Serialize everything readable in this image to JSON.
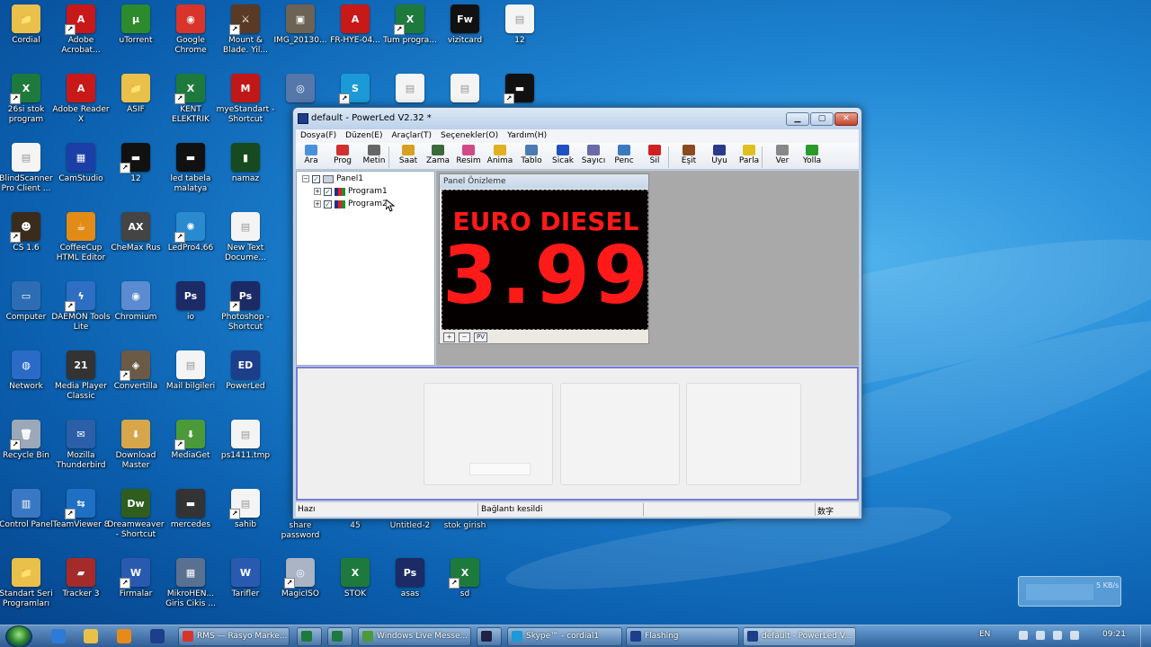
{
  "desktop": {
    "icons": [
      {
        "label": "Cordial",
        "color": "#e9c14a",
        "glyph": "📁"
      },
      {
        "label": "Adobe Acrobat...",
        "color": "#c91818",
        "glyph": "A"
      },
      {
        "label": "uTorrent",
        "color": "#2d8a2d",
        "glyph": "µ"
      },
      {
        "label": "Google Chrome",
        "color": "#d8342c",
        "glyph": "◉"
      },
      {
        "label": "Mount & Blade. Yil...",
        "color": "#5a3a25",
        "glyph": "⚔"
      },
      {
        "label": "IMG_20130...",
        "color": "#6d6355",
        "glyph": "▣"
      },
      {
        "label": "FR-HYE-04...",
        "color": "#c91818",
        "glyph": "A"
      },
      {
        "label": "Tum progra...",
        "color": "#1e7a3c",
        "glyph": "X"
      },
      {
        "label": "vizitcard",
        "color": "#111111",
        "glyph": "Fw"
      },
      {
        "label": "12",
        "color": "#f4f4f4",
        "glyph": "▤"
      },
      {
        "label": "26si stok program",
        "color": "#1e7a3c",
        "glyph": "X"
      },
      {
        "label": "Adobe Reader X",
        "color": "#c91818",
        "glyph": "A"
      },
      {
        "label": "ASIF",
        "color": "#e9c14a",
        "glyph": "📁"
      },
      {
        "label": "KENT ELEKTRIK",
        "color": "#1e7a3c",
        "glyph": "X"
      },
      {
        "label": "myeStandart - Shortcut",
        "color": "#c01818",
        "glyph": "M"
      },
      {
        "label": "",
        "color": "#5577aa",
        "glyph": "◎"
      },
      {
        "label": "",
        "color": "#1b9ad7",
        "glyph": "S"
      },
      {
        "label": "",
        "color": "#f4f4f4",
        "glyph": "▤"
      },
      {
        "label": "",
        "color": "#f4f4f4",
        "glyph": "▤"
      },
      {
        "label": "",
        "color": "#111111",
        "glyph": "▬"
      },
      {
        "label": "BlindScanner Pro Client ...",
        "color": "#f4f4f4",
        "glyph": "▤"
      },
      {
        "label": "CamStudio",
        "color": "#1b3fa6",
        "glyph": "▦"
      },
      {
        "label": "12",
        "color": "#111111",
        "glyph": "▬"
      },
      {
        "label": "led tabela malatya",
        "color": "#111111",
        "glyph": "▬"
      },
      {
        "label": "namaz",
        "color": "#174a1e",
        "glyph": "▮"
      },
      {
        "label": "CS 1.6",
        "color": "#3b2b1b",
        "glyph": "☻"
      },
      {
        "label": "CoffeeCup HTML Editor",
        "color": "#e38b17",
        "glyph": "☕"
      },
      {
        "label": "CheMax Rus",
        "color": "#444444",
        "glyph": "AX"
      },
      {
        "label": "LedPro4.66",
        "color": "#2a8ad0",
        "glyph": "✺"
      },
      {
        "label": "New Text Docume...",
        "color": "#f4f4f4",
        "glyph": "▤"
      },
      {
        "label": "Computer",
        "color": "#2c6db3",
        "glyph": "▭"
      },
      {
        "label": "DAEMON Tools Lite",
        "color": "#2e6fc4",
        "glyph": "ϟ"
      },
      {
        "label": "Chromium",
        "color": "#5b8bd1",
        "glyph": "◉"
      },
      {
        "label": "io",
        "color": "#1c2a66",
        "glyph": "Ps"
      },
      {
        "label": "Photoshop - Shortcut",
        "color": "#1c2a66",
        "glyph": "Ps"
      },
      {
        "label": "Network",
        "color": "#2a6bc7",
        "glyph": "◍"
      },
      {
        "label": "Media Player Classic",
        "color": "#333333",
        "glyph": "21"
      },
      {
        "label": "Convertilla",
        "color": "#6b5a45",
        "glyph": "◈"
      },
      {
        "label": "Mail bilgileri",
        "color": "#f4f4f4",
        "glyph": "▤"
      },
      {
        "label": "PowerLed",
        "color": "#1d3e8a",
        "glyph": "ED"
      },
      {
        "label": "Recycle Bin",
        "color": "#9aa8b8",
        "glyph": "🗑"
      },
      {
        "label": "Mozilla Thunderbird",
        "color": "#2b5fa8",
        "glyph": "✉"
      },
      {
        "label": "Download Master",
        "color": "#d7a64a",
        "glyph": "⬇"
      },
      {
        "label": "MediaGet",
        "color": "#4a9a3a",
        "glyph": "⬇"
      },
      {
        "label": "ps1411.tmp",
        "color": "#f4f4f4",
        "glyph": "▤"
      },
      {
        "label": "Control Panel",
        "color": "#3a78c4",
        "glyph": "▥"
      },
      {
        "label": "TeamViewer 8",
        "color": "#1f6fc4",
        "glyph": "⇆"
      },
      {
        "label": "Dreamweaver - Shortcut",
        "color": "#2f5d1e",
        "glyph": "Dw"
      },
      {
        "label": "mercedes",
        "color": "#333333",
        "glyph": "▬"
      },
      {
        "label": "sahib",
        "color": "#f4f4f4",
        "glyph": "▤"
      },
      {
        "label": "Standart Seri Programları",
        "color": "#e9c14a",
        "glyph": "📁"
      },
      {
        "label": "Tracker 3",
        "color": "#a52a2a",
        "glyph": "▰"
      },
      {
        "label": "Firmalar",
        "color": "#2a5ab0",
        "glyph": "W"
      },
      {
        "label": "MikroHEN... Giris Cikis ...",
        "color": "#5a7090",
        "glyph": "▦"
      },
      {
        "label": "Tarifler",
        "color": "#2a5ab0",
        "glyph": "W"
      },
      {
        "label": "MagicISO",
        "color": "#aab4c4",
        "glyph": "◎"
      },
      {
        "label": "STOK",
        "color": "#1e7a3c",
        "glyph": "X"
      },
      {
        "label": "asas",
        "color": "#1c2a66",
        "glyph": "Ps"
      },
      {
        "label": "sd",
        "color": "#1e7a3c",
        "glyph": "X"
      }
    ],
    "hidden_labels": [
      "share password",
      "45",
      "Untitled-2",
      "stok girish"
    ]
  },
  "window": {
    "title": "default - PowerLed V2.32 *",
    "controls": {
      "min": "▁",
      "max": "▢",
      "close": "✕"
    },
    "menu": [
      "Dosya(F)",
      "Düzen(E)",
      "Araçlar(T)",
      "Seçenekler(O)",
      "Yardım(H)"
    ],
    "toolbar": [
      {
        "label": "Ara",
        "color": "#4a90d9"
      },
      {
        "label": "Prog",
        "color": "#d03030"
      },
      {
        "label": "Metin",
        "color": "#666666"
      },
      {
        "label": "Saat",
        "color": "#d8a020"
      },
      {
        "label": "Zama",
        "color": "#3a6a3a"
      },
      {
        "label": "Resim",
        "color": "#d04a8a"
      },
      {
        "label": "Anima",
        "color": "#e0b020"
      },
      {
        "label": "Tablo",
        "color": "#4a7ab0"
      },
      {
        "label": "Sicak",
        "color": "#2050c0"
      },
      {
        "label": "Sayıcı",
        "color": "#6a6aaa"
      },
      {
        "label": "Penc",
        "color": "#3a7ac0"
      },
      {
        "label": "Sil",
        "color": "#d02020"
      },
      {
        "label": "Eşit",
        "color": "#8a4a20"
      },
      {
        "label": "Uyu",
        "color": "#2a3a8a"
      },
      {
        "label": "Parla",
        "color": "#e0c020"
      },
      {
        "label": "Ver",
        "color": "#888888"
      },
      {
        "label": "Yolla",
        "color": "#2a9a2a"
      }
    ],
    "tree": {
      "root": "Panel1",
      "children": [
        "Program1",
        "Program2"
      ],
      "expander_collapsed": "+",
      "expander_expanded": "−",
      "check_mark": "✓"
    },
    "preview": {
      "title": "Panel Önizleme",
      "line1": "EURO DIESEL",
      "line2": "3.99",
      "led_color": "#ff1a1a",
      "buttons": [
        "+",
        "−",
        "PV"
      ]
    },
    "status": {
      "left": "Hazı",
      "middle": "Bağlantı kesildi",
      "right": "数字"
    }
  },
  "gadget": {
    "speed": "5 KB/s"
  },
  "taskbar": {
    "buttons": [
      {
        "label": "RMS — Rasyo Marke...",
        "color": "#d8342c"
      },
      {
        "label": "",
        "color": "#1e7a3c"
      },
      {
        "label": "",
        "color": "#1e7a3c"
      },
      {
        "label": "Windows Live Messe...",
        "color": "#4a9a3a"
      },
      {
        "label": "",
        "color": "#222244"
      },
      {
        "label": "Skype™ - cordial1",
        "color": "#1b9ad7"
      },
      {
        "label": "Flashing",
        "color": "#1d3e8a"
      },
      {
        "label": "default - PowerLed V...",
        "color": "#1d3e8a"
      }
    ],
    "language": "EN",
    "clock": "09:21"
  }
}
